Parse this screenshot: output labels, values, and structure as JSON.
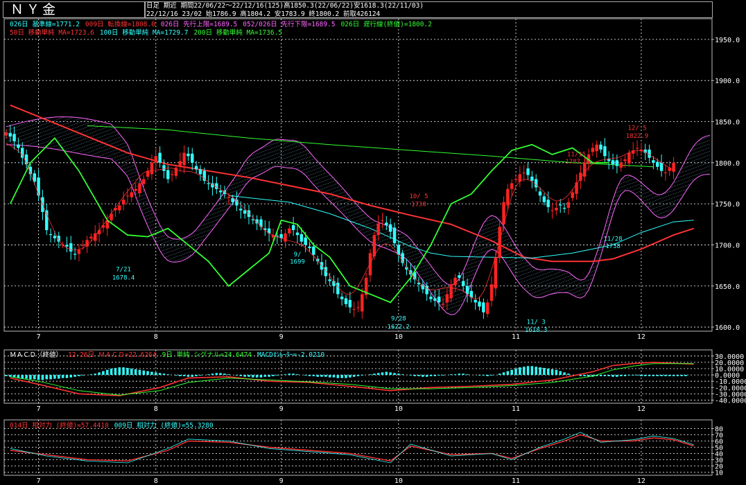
{
  "header": {
    "title": "ＮＹ金",
    "period_line": "日足 期近 期間22/06/22～22/12/16(125)高1850.3(22/06/22)安1618.3(22/11/03)",
    "ohlc_line": "22/12/16 23/02 始1786.9 高1804.2 安1783.9 終1800.2 前取426124"
  },
  "legend": {
    "row1": [
      {
        "text": "026日 基準線=1771.2",
        "color": "#33ffff"
      },
      {
        "text": "009日 転換線=1808.0",
        "color": "#ff3333"
      },
      {
        "text": "026日 先行上限=1689.5",
        "color": "#ff66ff"
      },
      {
        "text": "052/026日 先行下限=1689.5",
        "color": "#ff66ff"
      },
      {
        "text": "026日 遅行線(終値)=1800.2",
        "color": "#33ff33"
      }
    ],
    "row2": [
      {
        "text": "50日 移動単純 MA=1723.6",
        "color": "#ff3333"
      },
      {
        "text": "100日 移動単純 MA=1729.7",
        "color": "#33ffff"
      },
      {
        "text": "200日 移動単純 MA=1736.5",
        "color": "#33ff33"
      }
    ],
    "macd": [
      {
        "text": "ＭＡＣＤ（終値）",
        "color": "#ffffff"
      },
      {
        "text": "12-26日 ＭＡＣＤ=22.6264",
        "color": "#ff3333"
      },
      {
        "text": "9日 単純 シグナル=24.6474",
        "color": "#33ff33"
      },
      {
        "text": "MACDｵｼﾚｰﾀｰ=-2.0210",
        "color": "#33ffff"
      }
    ],
    "rsi": [
      {
        "text": "014日 相対力 (終値)=57.4410",
        "color": "#ff3333"
      },
      {
        "text": "009日 相対力 (終値)=55.3280",
        "color": "#33ffff"
      }
    ]
  },
  "annotations": [
    {
      "text": "7/21",
      "x": 29,
      "y": 1668,
      "color": "#33ffff"
    },
    {
      "text": "1678.4",
      "x": 29,
      "y": 1658,
      "color": "#33ffff"
    },
    {
      "text": "9/",
      "x": 72,
      "y": 1686,
      "color": "#33ffff"
    },
    {
      "text": "1699",
      "x": 72,
      "y": 1677,
      "color": "#33ffff"
    },
    {
      "text": "9/28",
      "x": 97,
      "y": 1608,
      "color": "#33ffff"
    },
    {
      "text": "1622.2",
      "x": 97,
      "y": 1598,
      "color": "#33ffff"
    },
    {
      "text": "10/ 5",
      "x": 102,
      "y": 1757,
      "color": "#ff3333"
    },
    {
      "text": "1730",
      "x": 102,
      "y": 1747,
      "color": "#ff3333"
    },
    {
      "text": "11/ 3",
      "x": 131,
      "y": 1604,
      "color": "#33ffff"
    },
    {
      "text": "1618.3",
      "x": 131,
      "y": 1594,
      "color": "#33ffff"
    },
    {
      "text": "11/15",
      "x": 141,
      "y": 1808,
      "color": "#ff3333"
    },
    {
      "text": "1787.9",
      "x": 141,
      "y": 1799,
      "color": "#ff3333"
    },
    {
      "text": "11/28",
      "x": 150,
      "y": 1705,
      "color": "#33ffff"
    },
    {
      "text": "1738",
      "x": 150,
      "y": 1696,
      "color": "#33ffff"
    },
    {
      "text": "12/ 5",
      "x": 156,
      "y": 1840,
      "color": "#ff3333"
    },
    {
      "text": "1822.9",
      "x": 156,
      "y": 1830,
      "color": "#ff3333"
    }
  ],
  "chart_data": [
    {
      "type": "candlestick",
      "panel": "price",
      "y_ticks": [
        1950,
        1900,
        1850,
        1800,
        1750,
        1700,
        1650,
        1600
      ],
      "ylim": [
        1595,
        1960
      ],
      "x_ticks": [
        {
          "label": "7",
          "i": 8
        },
        {
          "label": "8",
          "i": 37
        },
        {
          "label": "9",
          "i": 68
        },
        {
          "label": "10",
          "i": 97
        },
        {
          "label": "11",
          "i": 126
        },
        {
          "label": "12",
          "i": 157
        }
      ],
      "candle_count": 175,
      "close": [
        1837,
        1832,
        1826,
        1818,
        1806,
        1798,
        1786,
        1777,
        1760,
        1740,
        1718,
        1712,
        1708,
        1704,
        1700,
        1698,
        1692,
        1688,
        1694,
        1700,
        1706,
        1710,
        1714,
        1718,
        1724,
        1730,
        1738,
        1745,
        1748,
        1755,
        1760,
        1764,
        1768,
        1775,
        1780,
        1790,
        1800,
        1808,
        1800,
        1790,
        1780,
        1786,
        1794,
        1802,
        1812,
        1808,
        1800,
        1792,
        1786,
        1778,
        1774,
        1770,
        1768,
        1764,
        1762,
        1758,
        1752,
        1748,
        1742,
        1738,
        1734,
        1730,
        1726,
        1722,
        1718,
        1714,
        1712,
        1710,
        1708,
        1714,
        1720,
        1718,
        1712,
        1704,
        1700,
        1696,
        1688,
        1680,
        1670,
        1662,
        1656,
        1650,
        1640,
        1634,
        1628,
        1624,
        1622,
        1624,
        1640,
        1660,
        1690,
        1712,
        1726,
        1730,
        1724,
        1716,
        1702,
        1688,
        1678,
        1670,
        1664,
        1658,
        1652,
        1646,
        1640,
        1634,
        1632,
        1630,
        1628,
        1640,
        1652,
        1660,
        1660,
        1650,
        1640,
        1636,
        1630,
        1625,
        1618,
        1630,
        1652,
        1685,
        1722,
        1752,
        1768,
        1775,
        1780,
        1786,
        1788,
        1785,
        1778,
        1770,
        1760,
        1752,
        1746,
        1742,
        1745,
        1748,
        1744,
        1752,
        1764,
        1776,
        1788,
        1800,
        1810,
        1818,
        1822,
        1816,
        1808,
        1802,
        1798,
        1796,
        1800,
        1804,
        1812,
        1815,
        1818,
        1816,
        1812,
        1806,
        1800,
        1795,
        1790,
        1788,
        1794,
        1800
      ],
      "ma_series": [
        {
          "name": "50日 移動単純",
          "color": "#ff3333",
          "values": [
            [
              1,
              1870
            ],
            [
              10,
              1852
            ],
            [
              20,
              1832
            ],
            [
              30,
              1812
            ],
            [
              40,
              1798
            ],
            [
              50,
              1790
            ],
            [
              60,
              1782
            ],
            [
              70,
              1772
            ],
            [
              80,
              1762
            ],
            [
              90,
              1748
            ],
            [
              100,
              1736
            ],
            [
              110,
              1725
            ],
            [
              120,
              1705
            ],
            [
              128,
              1685
            ],
            [
              135,
              1680
            ],
            [
              145,
              1680
            ],
            [
              150,
              1683
            ],
            [
              157,
              1695
            ],
            [
              165,
              1712
            ],
            [
              170,
              1720
            ]
          ]
        },
        {
          "name": "100日 移動単純",
          "color": "#33ffff",
          "values": [
            [
              55,
              1760
            ],
            [
              70,
              1752
            ],
            [
              80,
              1738
            ],
            [
              90,
              1720
            ],
            [
              100,
              1698
            ],
            [
              105,
              1690
            ],
            [
              110,
              1686
            ],
            [
              120,
              1685
            ],
            [
              130,
              1684
            ],
            [
              140,
              1690
            ],
            [
              150,
              1700
            ],
            [
              157,
              1715
            ],
            [
              165,
              1728
            ],
            [
              170,
              1730
            ]
          ]
        },
        {
          "name": "200日 移動単純",
          "color": "#33ff33",
          "values": [
            [
              20,
              1845
            ],
            [
              40,
              1840
            ],
            [
              60,
              1830
            ],
            [
              80,
              1822
            ],
            [
              100,
              1815
            ],
            [
              120,
              1808
            ],
            [
              140,
              1800
            ],
            [
              160,
              1795
            ]
          ]
        }
      ],
      "lagging_span": {
        "name": "遅行線",
        "color": "#33ff33",
        "values": [
          [
            1,
            1750
          ],
          [
            6,
            1800
          ],
          [
            12,
            1830
          ],
          [
            18,
            1790
          ],
          [
            25,
            1730
          ],
          [
            30,
            1712
          ],
          [
            35,
            1710
          ],
          [
            40,
            1720
          ],
          [
            45,
            1700
          ],
          [
            50,
            1680
          ],
          [
            55,
            1650
          ],
          [
            60,
            1670
          ],
          [
            65,
            1690
          ],
          [
            68,
            1730
          ],
          [
            72,
            1725
          ],
          [
            76,
            1700
          ],
          [
            80,
            1685
          ],
          [
            85,
            1650
          ],
          [
            90,
            1640
          ],
          [
            95,
            1630
          ],
          [
            100,
            1660
          ],
          [
            105,
            1700
          ],
          [
            110,
            1750
          ],
          [
            115,
            1762
          ],
          [
            120,
            1790
          ],
          [
            125,
            1815
          ],
          [
            130,
            1822
          ],
          [
            135,
            1810
          ],
          [
            140,
            1818
          ],
          [
            145,
            1800
          ],
          [
            149,
            1800
          ]
        ]
      }
    },
    {
      "type": "line",
      "panel": "macd",
      "y_ticks": [
        30,
        20,
        10,
        0,
        -10,
        -20,
        -30,
        -40
      ],
      "ylim": [
        -45,
        32
      ],
      "series": [
        {
          "name": "MACD",
          "color": "#ff3333",
          "values": [
            [
              1,
              -5
            ],
            [
              8,
              -15
            ],
            [
              18,
              -30
            ],
            [
              28,
              -33
            ],
            [
              38,
              -20
            ],
            [
              45,
              -5
            ],
            [
              55,
              -3
            ],
            [
              65,
              -10
            ],
            [
              75,
              -12
            ],
            [
              85,
              -18
            ],
            [
              95,
              -25
            ],
            [
              105,
              -20
            ],
            [
              115,
              -18
            ],
            [
              125,
              -15
            ],
            [
              135,
              -8
            ],
            [
              145,
              5
            ],
            [
              150,
              15
            ],
            [
              155,
              18
            ],
            [
              160,
              20
            ],
            [
              170,
              17
            ]
          ]
        },
        {
          "name": "シグナル",
          "color": "#33ff33",
          "values": [
            [
              1,
              -3
            ],
            [
              8,
              -10
            ],
            [
              18,
              -25
            ],
            [
              28,
              -32
            ],
            [
              38,
              -25
            ],
            [
              45,
              -12
            ],
            [
              55,
              -5
            ],
            [
              65,
              -8
            ],
            [
              75,
              -11
            ],
            [
              85,
              -15
            ],
            [
              95,
              -22
            ],
            [
              105,
              -22
            ],
            [
              115,
              -20
            ],
            [
              125,
              -17
            ],
            [
              135,
              -12
            ],
            [
              145,
              -2
            ],
            [
              150,
              8
            ],
            [
              155,
              14
            ],
            [
              160,
              18
            ],
            [
              170,
              18
            ]
          ]
        }
      ],
      "oscillator": [
        -2,
        -3,
        -4,
        -5,
        -6,
        -6,
        -7,
        -7,
        -8,
        -8,
        -7,
        -7,
        -6,
        -6,
        -5,
        -5,
        -4,
        -3,
        -2,
        -1,
        0,
        1,
        2,
        4,
        6,
        8,
        10,
        11,
        12,
        12,
        11,
        10,
        9,
        8,
        7,
        6,
        5,
        4,
        3,
        2,
        1,
        0,
        -1,
        -2,
        -2,
        -3,
        -3,
        -2,
        -1,
        0,
        1,
        2,
        3,
        3,
        2,
        1,
        0,
        -1,
        -2,
        -3,
        -3,
        -4,
        -4,
        -4,
        -3,
        -3,
        -2,
        -1,
        0,
        1,
        2,
        2,
        1,
        0,
        -1,
        -2,
        -2,
        -3,
        -3,
        -3,
        -4,
        -4,
        -5,
        -5,
        -5,
        -4,
        -3,
        -2,
        -1,
        0,
        1,
        2,
        3,
        4,
        5,
        4,
        3,
        2,
        1,
        0,
        -1,
        -2,
        -2,
        -3,
        -3,
        -2,
        -2,
        -1,
        -1,
        0,
        1,
        1,
        2,
        2,
        1,
        0,
        0,
        -1,
        -1,
        -2,
        -1,
        0,
        2,
        4,
        6,
        8,
        10,
        12,
        13,
        14,
        14,
        13,
        12,
        11,
        10,
        9,
        8,
        6,
        4,
        2,
        0,
        -1,
        -2,
        -2,
        -3,
        -3,
        -2,
        -2,
        -2,
        -2,
        -3,
        -3,
        -2,
        -2,
        -1,
        -1,
        -1,
        -2,
        -2,
        -2,
        -2,
        -2,
        -2,
        -2,
        -2,
        -2,
        -2,
        -2,
        -2
      ]
    },
    {
      "type": "line",
      "panel": "rsi",
      "y_ticks": [
        80,
        70,
        60,
        50,
        40,
        30,
        20,
        10
      ],
      "ylim": [
        5,
        85
      ],
      "series": [
        {
          "name": "014日 相対力",
          "color": "#ff3333",
          "values": [
            [
              1,
              45
            ],
            [
              10,
              38
            ],
            [
              20,
              30
            ],
            [
              30,
              28
            ],
            [
              40,
              45
            ],
            [
              45,
              60
            ],
            [
              55,
              58
            ],
            [
              65,
              50
            ],
            [
              75,
              45
            ],
            [
              85,
              40
            ],
            [
              95,
              28
            ],
            [
              100,
              52
            ],
            [
              110,
              38
            ],
            [
              120,
              40
            ],
            [
              125,
              32
            ],
            [
              132,
              48
            ],
            [
              138,
              60
            ],
            [
              142,
              70
            ],
            [
              147,
              60
            ],
            [
              155,
              60
            ],
            [
              160,
              65
            ],
            [
              165,
              62
            ],
            [
              170,
              52
            ]
          ]
        },
        {
          "name": "009日 相対力",
          "color": "#33ffff",
          "values": [
            [
              1,
              48
            ],
            [
              10,
              36
            ],
            [
              20,
              28
            ],
            [
              30,
              25
            ],
            [
              40,
              48
            ],
            [
              45,
              63
            ],
            [
              55,
              60
            ],
            [
              65,
              48
            ],
            [
              75,
              43
            ],
            [
              85,
              38
            ],
            [
              95,
              25
            ],
            [
              100,
              55
            ],
            [
              110,
              36
            ],
            [
              120,
              40
            ],
            [
              125,
              30
            ],
            [
              132,
              50
            ],
            [
              138,
              63
            ],
            [
              142,
              74
            ],
            [
              147,
              58
            ],
            [
              155,
              62
            ],
            [
              160,
              68
            ],
            [
              165,
              64
            ],
            [
              170,
              54
            ]
          ]
        }
      ]
    }
  ]
}
